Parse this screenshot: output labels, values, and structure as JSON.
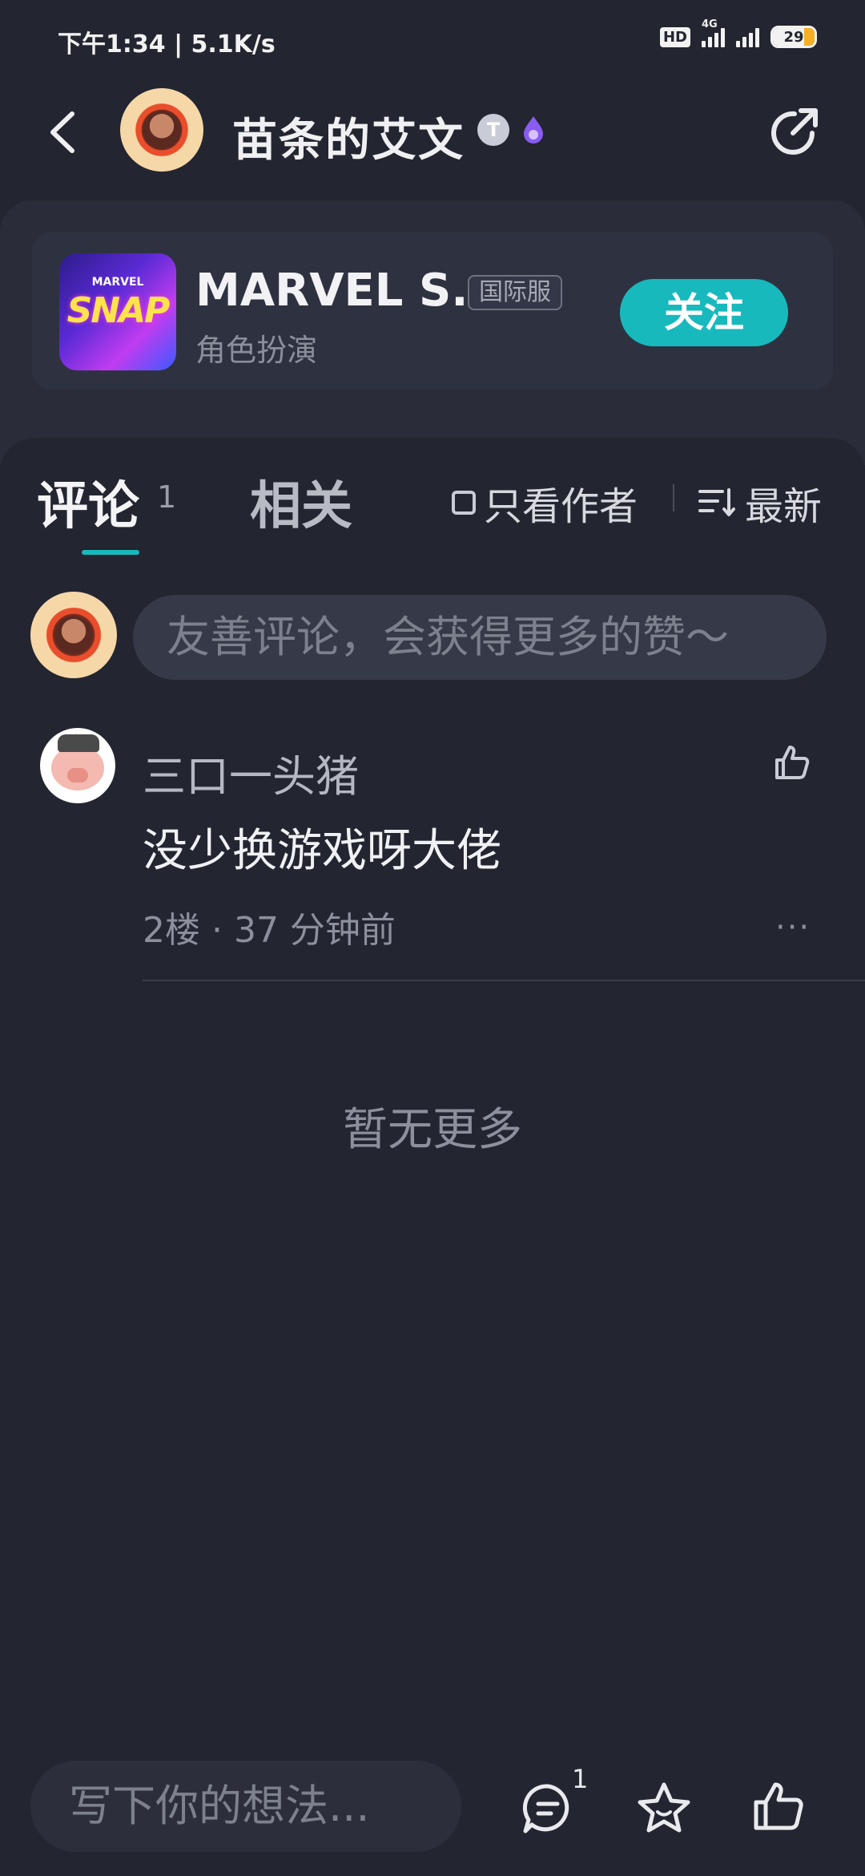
{
  "status_bar": {
    "time": "下午1:34 | 5.1K/s",
    "hd_label": "HD",
    "network_label": "4G",
    "battery": "29"
  },
  "header": {
    "author_name": "苗条的艾文",
    "badge_letter": "T"
  },
  "game": {
    "title": "MARVEL S...",
    "region_tag": "国际服",
    "genre": "角色扮演",
    "icon_small_text": "MARVEL",
    "icon_big_text": "SNAP",
    "follow_label": "关注"
  },
  "tabs": {
    "comments_label": "评论",
    "comments_count": "1",
    "related_label": "相关",
    "only_author_label": "只看作者",
    "sort_label": "最新"
  },
  "comment_input": {
    "placeholder": "友善评论，会获得更多的赞～"
  },
  "comments": [
    {
      "user": "三口一头猪",
      "text": "没少换游戏呀大佬",
      "meta": "2楼 · 37 分钟前",
      "more": "···"
    }
  ],
  "footer_note": "暂无更多",
  "bottom_bar": {
    "write_placeholder": "写下你的想法...",
    "comment_count": "1"
  },
  "colors": {
    "accent": "#18b9bd",
    "background": "#232530"
  }
}
